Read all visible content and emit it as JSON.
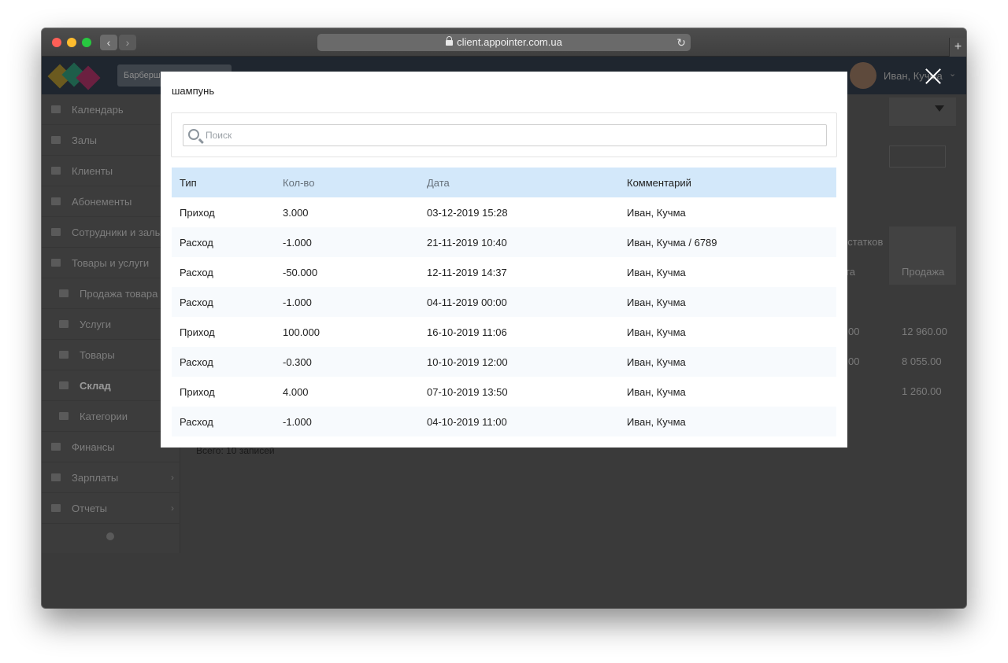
{
  "browser": {
    "url": "client.appointer.com.ua",
    "back_glyph": "‹",
    "forward_glyph": "›",
    "reload_glyph": "↻",
    "newtab_glyph": "+"
  },
  "header": {
    "org_select": "Барбершоп",
    "user_name": "Иван, Кучма",
    "chevron_glyph": "⌄"
  },
  "sidebar": {
    "items": [
      {
        "label": "Календарь"
      },
      {
        "label": "Залы"
      },
      {
        "label": "Клиенты"
      },
      {
        "label": "Абонементы"
      },
      {
        "label": "Сотрудники и залы"
      },
      {
        "label": "Товары и услуги"
      },
      {
        "label": "Продажа товара"
      },
      {
        "label": "Услуги"
      },
      {
        "label": "Товары"
      },
      {
        "label": "Склад"
      },
      {
        "label": "Категории"
      },
      {
        "label": "Финансы"
      },
      {
        "label": "Зарплаты"
      },
      {
        "label": "Отчеты"
      }
    ],
    "arrow_glyph": "›"
  },
  "background": {
    "col_remains": "остатков",
    "col_a": "та",
    "col_sale": "Продажа",
    "row1_a": "00",
    "row1_sale": "12 960.00",
    "row2_a": "00",
    "row2_sale": "8 055.00",
    "row3_sale": "1 260.00",
    "total": "Всего: 10 записей"
  },
  "modal": {
    "title": "шампунь",
    "search_placeholder": "Поиск",
    "columns": {
      "type": "Тип",
      "qty": "Кол-во",
      "date": "Дата",
      "comment": "Комментарий"
    },
    "rows": [
      {
        "type": "Приход",
        "qty": "3.000",
        "date": "03-12-2019 15:28",
        "comment": "Иван, Кучма"
      },
      {
        "type": "Расход",
        "qty": "-1.000",
        "date": "21-11-2019 10:40",
        "comment": "Иван, Кучма / 6789"
      },
      {
        "type": "Расход",
        "qty": "-50.000",
        "date": "12-11-2019 14:37",
        "comment": "Иван, Кучма"
      },
      {
        "type": "Расход",
        "qty": "-1.000",
        "date": "04-11-2019 00:00",
        "comment": "Иван, Кучма"
      },
      {
        "type": "Приход",
        "qty": "100.000",
        "date": "16-10-2019 11:06",
        "comment": "Иван, Кучма"
      },
      {
        "type": "Расход",
        "qty": "-0.300",
        "date": "10-10-2019 12:00",
        "comment": "Иван, Кучма"
      },
      {
        "type": "Приход",
        "qty": "4.000",
        "date": "07-10-2019 13:50",
        "comment": "Иван, Кучма"
      },
      {
        "type": "Расход",
        "qty": "-1.000",
        "date": "04-10-2019 11:00",
        "comment": "Иван, Кучма"
      }
    ]
  }
}
